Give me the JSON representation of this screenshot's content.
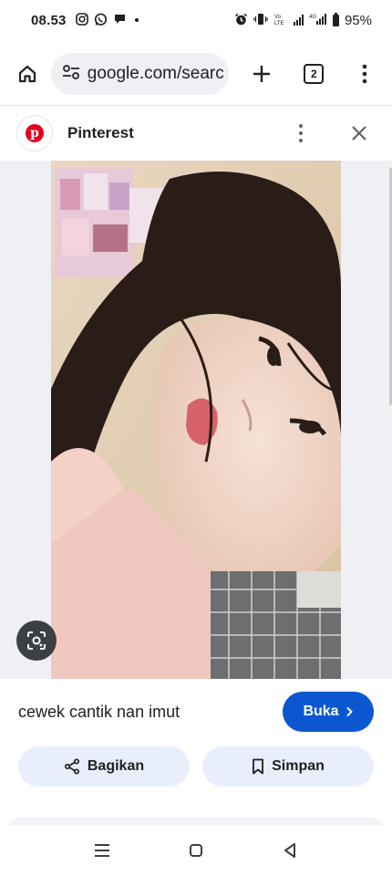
{
  "status_bar": {
    "time": "08.53",
    "battery": "95%",
    "icons": [
      "instagram-icon",
      "whatsapp-icon",
      "chat-icon",
      "dot-icon",
      "alarm-icon",
      "vibrate-icon",
      "volte-icon",
      "signal-icon",
      "signal-4g-icon",
      "battery-icon"
    ]
  },
  "browser": {
    "url": "google.com/searc",
    "tab_count": "2"
  },
  "source": {
    "name": "Pinterest",
    "logo_letter": "p"
  },
  "result": {
    "caption": "cewek cantik nan imut",
    "visit_label": "Buka",
    "share_label": "Bagikan",
    "save_label": "Simpan"
  },
  "colors": {
    "accent": "#0b57d0",
    "pinterest": "#e60023",
    "pill_bg": "#e8eefb",
    "image_bg": "#eef0f4"
  }
}
